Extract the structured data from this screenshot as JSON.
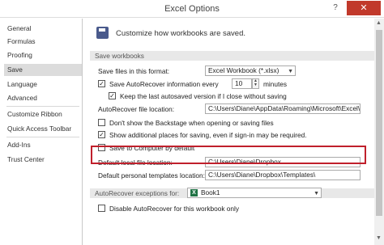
{
  "window": {
    "title": "Excel Options",
    "help": "?",
    "close": "✕"
  },
  "sidebar": {
    "items": [
      {
        "label": "General"
      },
      {
        "label": "Formulas"
      },
      {
        "label": "Proofing"
      },
      {
        "label": "Save",
        "active": true
      },
      {
        "label": "Language"
      },
      {
        "label": "Advanced"
      },
      {
        "label": "Customize Ribbon"
      },
      {
        "label": "Quick Access Toolbar"
      },
      {
        "label": "Add-Ins"
      },
      {
        "label": "Trust Center"
      }
    ]
  },
  "header": {
    "text": "Customize how workbooks are saved."
  },
  "save_section": {
    "title": "Save workbooks",
    "format_label": "Save files in this format:",
    "format_value": "Excel Workbook (*.xlsx)",
    "autorecover_label": "Save AutoRecover information every",
    "autorecover_minutes": "10",
    "minutes_label": "minutes",
    "autorecover_checked": true,
    "keep_last_label": "Keep the last autosaved version if I close without saving",
    "keep_last_checked": true,
    "autorecover_location_label": "AutoRecover file location:",
    "autorecover_location_value": "C:\\Users\\Diane\\AppData\\Roaming\\Microsoft\\Excel\\",
    "backstage_label": "Don't show the Backstage when opening or saving files",
    "backstage_checked": false,
    "additional_places_label": "Show additional places for saving, even if sign-in may be required.",
    "additional_places_checked": true,
    "save_computer_label": "Save to Computer by default",
    "save_computer_checked": false,
    "default_local_label": "Default local file location:",
    "default_local_value": "C:\\Users\\Diane\\Dropbox",
    "personal_templates_label": "Default personal templates location:",
    "personal_templates_value": "C:\\Users\\Diane\\Dropbox\\Templates\\"
  },
  "exceptions_section": {
    "title": "AutoRecover exceptions for:",
    "workbook": "Book1",
    "disable_label": "Disable AutoRecover for this workbook only",
    "disable_checked": false
  },
  "colors": {
    "highlight": "#c0202c",
    "active_nav": "#dcdcdc",
    "excel_green": "#207245"
  }
}
